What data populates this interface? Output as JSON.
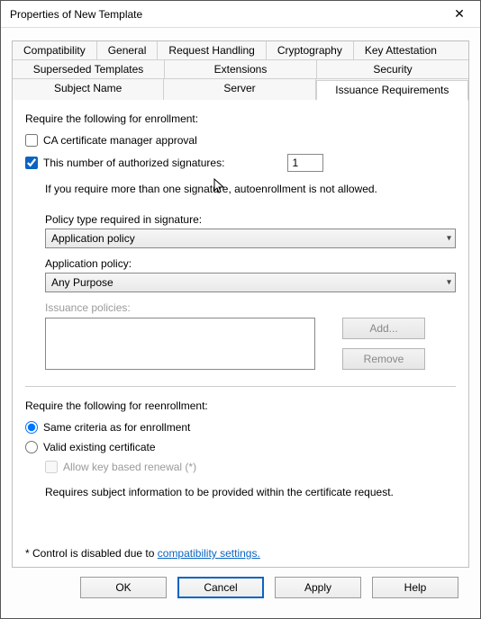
{
  "window": {
    "title": "Properties of New Template",
    "close_icon": "✕"
  },
  "tabs": {
    "row1": [
      "Compatibility",
      "General",
      "Request Handling",
      "Cryptography",
      "Key Attestation"
    ],
    "row2": [
      "Superseded Templates",
      "Extensions",
      "Security"
    ],
    "row3": [
      "Subject Name",
      "Server",
      "Issuance Requirements"
    ],
    "active": "Issuance Requirements"
  },
  "enroll": {
    "section": "Require the following for enrollment:",
    "ca_approval": "CA certificate manager approval",
    "auth_sig": "This number of authorized signatures:",
    "auth_sig_value": "1",
    "hint": "If you require more than one signature, autoenrollment is not allowed.",
    "policy_type_label": "Policy type required in signature:",
    "policy_type_value": "Application policy",
    "app_policy_label": "Application policy:",
    "app_policy_value": "Any Purpose",
    "issuance_policies_label": "Issuance policies:",
    "add_btn": "Add...",
    "remove_btn": "Remove"
  },
  "reenroll": {
    "section": "Require the following for reenrollment:",
    "same": "Same criteria as for enrollment",
    "valid": "Valid existing certificate",
    "allow_key": "Allow key based renewal (*)",
    "note": "Requires subject information to be provided within the certificate request."
  },
  "footnote": {
    "prefix": "* Control is disabled due to ",
    "link": "compatibility settings."
  },
  "buttons": {
    "ok": "OK",
    "cancel": "Cancel",
    "apply": "Apply",
    "help": "Help"
  }
}
